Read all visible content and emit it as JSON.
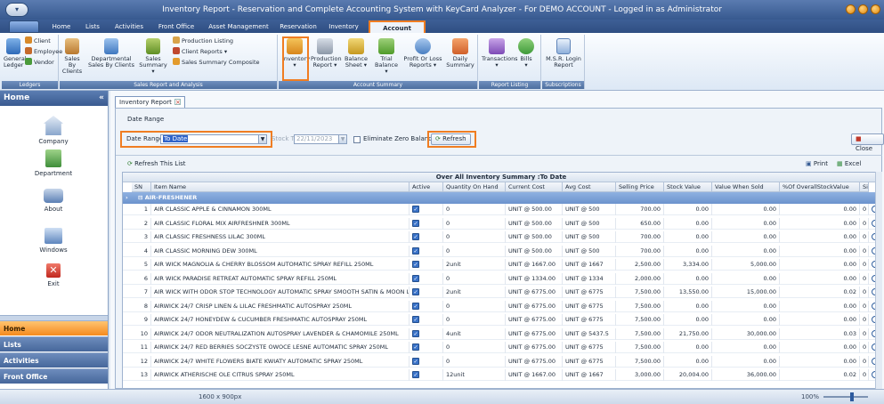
{
  "window": {
    "title": "Inventory Report - Reservation and Complete Accounting System with KeyCard Analyzer - For DEMO ACCOUNT - Logged in as Administrator"
  },
  "ribbon_tabs": [
    "Home",
    "Lists",
    "Activities",
    "Front Office",
    "Asset Management",
    "Reservation",
    "Inventory",
    "Account Report"
  ],
  "ribbon": {
    "ledgers": {
      "label": "Ledgers",
      "general_ledger": "General Ledger",
      "client": "Client",
      "employee": "Employee",
      "vendor": "Vendor"
    },
    "sales": {
      "label": "Sales Report and Analysis",
      "sales_by_clients": "Sales By Clients",
      "departmental": "Departmental Sales By Clients",
      "sales_summary": "Sales Summary",
      "production_listing": "Production Listing",
      "client_reports": "Client Reports",
      "sales_summary_composite": "Sales Summary Composite"
    },
    "account": {
      "label": "Account Summary",
      "inventory": "Inventory",
      "production_report": "Production Report",
      "balance_sheet": "Balance Sheet",
      "trial_balance": "Trial Balance",
      "profit_loss": "Profit Or Loss Reports",
      "daily_summary": "Daily Summary"
    },
    "report_listing": {
      "label": "Report Listing",
      "transactions": "Transactions",
      "bills": "Bills"
    },
    "subscriptions": {
      "label": "Subscriptions",
      "msr_login": "M.S.R. Login Report"
    }
  },
  "sidebar": {
    "title": "Home",
    "items": [
      {
        "label": "Company",
        "icon": "building-icon"
      },
      {
        "label": "Department",
        "icon": "org-chart-icon"
      },
      {
        "label": "About",
        "icon": "faucet-icon"
      },
      {
        "label": "Windows",
        "icon": "window-icon"
      },
      {
        "label": "Exit",
        "icon": "exit-icon"
      }
    ],
    "nav": [
      "Home",
      "Lists",
      "Activities",
      "Front Office"
    ]
  },
  "doc_tab": "Inventory Report",
  "filter": {
    "section_label": "Date Range",
    "date_range_label": "Date Range",
    "date_range_value": "To Date",
    "stock_till_label": "Stock Till",
    "stock_till_value": "22/11/2023",
    "eliminate_zero_label": "Eliminate Zero Balances",
    "refresh_label": "Refresh",
    "close_label": "Close"
  },
  "grid_toolbar": {
    "refresh_list": "Refresh This List",
    "print": "Print",
    "excel": "Excel"
  },
  "grid": {
    "title": "Over All Inventory Summary :To Date",
    "headers": [
      "SN",
      "Item Name",
      "Active",
      "Quantity On Hand",
      "Current Cost",
      "Avg Cost",
      "Selling Price",
      "Stock Value",
      "Value When Sold",
      "%Of OverallStockValue",
      "Si"
    ],
    "group": "AIR-FRESHENER",
    "rows": [
      {
        "sn": "1",
        "name": "AIR CLASSIC APPLE & CINNAMON 300ML",
        "qty": "0",
        "cost": "UNIT @ 500.00",
        "avg": "UNIT @ 500",
        "price": "700.00",
        "stock": "0.00",
        "sold": "0.00",
        "pct": "0.00",
        "si": "0"
      },
      {
        "sn": "2",
        "name": "AIR CLASSIC FLORAL MIX AIRFRESHNER 300ML",
        "qty": "0",
        "cost": "UNIT @ 500.00",
        "avg": "UNIT @ 500",
        "price": "650.00",
        "stock": "0.00",
        "sold": "0.00",
        "pct": "0.00",
        "si": "0"
      },
      {
        "sn": "3",
        "name": "AIR CLASSIC FRESHNESS LILAC 300ML",
        "qty": "0",
        "cost": "UNIT @ 500.00",
        "avg": "UNIT @ 500",
        "price": "700.00",
        "stock": "0.00",
        "sold": "0.00",
        "pct": "0.00",
        "si": "0"
      },
      {
        "sn": "4",
        "name": "AIR CLASSIC MORNING DEW 300ML",
        "qty": "0",
        "cost": "UNIT @ 500.00",
        "avg": "UNIT @ 500",
        "price": "700.00",
        "stock": "0.00",
        "sold": "0.00",
        "pct": "0.00",
        "si": "0"
      },
      {
        "sn": "5",
        "name": "AIR WICK MAGNOLIA & CHERRY BLOSSOM AUTOMATIC SPRAY REFILL 250ML",
        "qty": "2unit",
        "cost": "UNIT @ 1667.00",
        "avg": "UNIT @ 1667",
        "price": "2,500.00",
        "stock": "3,334.00",
        "sold": "5,000.00",
        "pct": "0.00",
        "si": "0"
      },
      {
        "sn": "6",
        "name": "AIR WICK PARADISE RETREAT AUTOMATIC SPRAY REFILL 250ML",
        "qty": "0",
        "cost": "UNIT @ 1334.00",
        "avg": "UNIT @ 1334",
        "price": "2,000.00",
        "stock": "0.00",
        "sold": "0.00",
        "pct": "0.00",
        "si": "0"
      },
      {
        "sn": "7",
        "name": "AIR WICK WITH ODOR STOP TECHNOLOGY AUTOMATIC SPRAY SMOOTH SATIN & MOON LILY",
        "qty": "2unit",
        "cost": "UNIT @ 6775.00",
        "avg": "UNIT @ 6775",
        "price": "7,500.00",
        "stock": "13,550.00",
        "sold": "15,000.00",
        "pct": "0.02",
        "si": "0"
      },
      {
        "sn": "8",
        "name": "AIRWICK 24/7 CRISP LINEN & LILAC FRESHMATIC AUTOSPRAY 250ML",
        "qty": "0",
        "cost": "UNIT @ 6775.00",
        "avg": "UNIT @ 6775",
        "price": "7,500.00",
        "stock": "0.00",
        "sold": "0.00",
        "pct": "0.00",
        "si": "0"
      },
      {
        "sn": "9",
        "name": "AIRWICK 24/7 HONEYDEW & CUCUMBER FRESHMATIC AUTOSPRAY 250ML",
        "qty": "0",
        "cost": "UNIT @ 6775.00",
        "avg": "UNIT @ 6775",
        "price": "7,500.00",
        "stock": "0.00",
        "sold": "0.00",
        "pct": "0.00",
        "si": "0"
      },
      {
        "sn": "10",
        "name": "AIRWICK 24/7 ODOR NEUTRALIZATION AUTOSPRAY LAVENDER & CHAMOMILE 250ML",
        "qty": "4unit",
        "cost": "UNIT @ 6775.00",
        "avg": "UNIT @ 5437.5",
        "price": "7,500.00",
        "stock": "21,750.00",
        "sold": "30,000.00",
        "pct": "0.03",
        "si": "0"
      },
      {
        "sn": "11",
        "name": "AIRWICK 24/7 RED BERRIES SOCZYSTE OWOCE LESNE AUTOMATIC SPRAY 250ML",
        "qty": "0",
        "cost": "UNIT @ 6775.00",
        "avg": "UNIT @ 6775",
        "price": "7,500.00",
        "stock": "0.00",
        "sold": "0.00",
        "pct": "0.00",
        "si": "0"
      },
      {
        "sn": "12",
        "name": "AIRWICK 24/7 WHITE FLOWERS BIATE KWIATY AUTOMATIC SPRAY 250ML",
        "qty": "0",
        "cost": "UNIT @ 6775.00",
        "avg": "UNIT @ 6775",
        "price": "7,500.00",
        "stock": "0.00",
        "sold": "0.00",
        "pct": "0.00",
        "si": "0"
      },
      {
        "sn": "13",
        "name": "AIRWICK ATHERISCHE OLE CITRUS SPRAY 250ML",
        "qty": "12unit",
        "cost": "UNIT @ 1667.00",
        "avg": "UNIT @ 1667",
        "price": "3,000.00",
        "stock": "20,004.00",
        "sold": "36,000.00",
        "pct": "0.02",
        "si": "0"
      }
    ]
  },
  "statusbar": {
    "resolution": "1600 x 900px",
    "zoom": "100%"
  },
  "colors": {
    "accent": "#f07d22",
    "ribbon_dark": "#37598f",
    "group_row": "#6c93cd"
  }
}
